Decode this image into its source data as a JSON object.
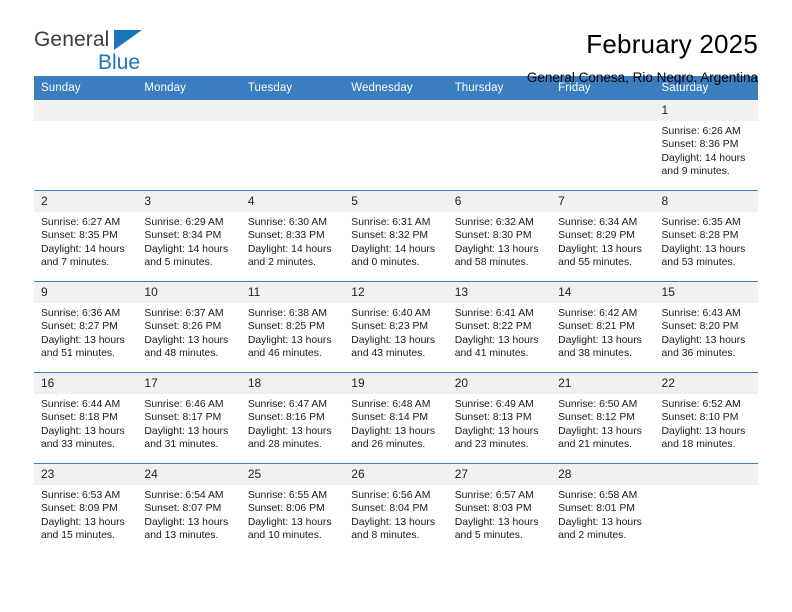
{
  "brand": {
    "name_part1": "General",
    "name_part2": "Blue",
    "triangle_color": "#1b75bb",
    "accent_color": "#3a7ebf"
  },
  "header": {
    "month_title": "February 2025",
    "location": "General Conesa, Rio Negro, Argentina"
  },
  "calendar": {
    "weekdays": [
      "Sunday",
      "Monday",
      "Tuesday",
      "Wednesday",
      "Thursday",
      "Friday",
      "Saturday"
    ],
    "weeks": [
      [
        {
          "day": "",
          "sunrise": "",
          "sunset": "",
          "daylight": "",
          "daylight2": ""
        },
        {
          "day": "",
          "sunrise": "",
          "sunset": "",
          "daylight": "",
          "daylight2": ""
        },
        {
          "day": "",
          "sunrise": "",
          "sunset": "",
          "daylight": "",
          "daylight2": ""
        },
        {
          "day": "",
          "sunrise": "",
          "sunset": "",
          "daylight": "",
          "daylight2": ""
        },
        {
          "day": "",
          "sunrise": "",
          "sunset": "",
          "daylight": "",
          "daylight2": ""
        },
        {
          "day": "",
          "sunrise": "",
          "sunset": "",
          "daylight": "",
          "daylight2": ""
        },
        {
          "day": "1",
          "sunrise": "Sunrise: 6:26 AM",
          "sunset": "Sunset: 8:36 PM",
          "daylight": "Daylight: 14 hours",
          "daylight2": "and 9 minutes."
        }
      ],
      [
        {
          "day": "2",
          "sunrise": "Sunrise: 6:27 AM",
          "sunset": "Sunset: 8:35 PM",
          "daylight": "Daylight: 14 hours",
          "daylight2": "and 7 minutes."
        },
        {
          "day": "3",
          "sunrise": "Sunrise: 6:29 AM",
          "sunset": "Sunset: 8:34 PM",
          "daylight": "Daylight: 14 hours",
          "daylight2": "and 5 minutes."
        },
        {
          "day": "4",
          "sunrise": "Sunrise: 6:30 AM",
          "sunset": "Sunset: 8:33 PM",
          "daylight": "Daylight: 14 hours",
          "daylight2": "and 2 minutes."
        },
        {
          "day": "5",
          "sunrise": "Sunrise: 6:31 AM",
          "sunset": "Sunset: 8:32 PM",
          "daylight": "Daylight: 14 hours",
          "daylight2": "and 0 minutes."
        },
        {
          "day": "6",
          "sunrise": "Sunrise: 6:32 AM",
          "sunset": "Sunset: 8:30 PM",
          "daylight": "Daylight: 13 hours",
          "daylight2": "and 58 minutes."
        },
        {
          "day": "7",
          "sunrise": "Sunrise: 6:34 AM",
          "sunset": "Sunset: 8:29 PM",
          "daylight": "Daylight: 13 hours",
          "daylight2": "and 55 minutes."
        },
        {
          "day": "8",
          "sunrise": "Sunrise: 6:35 AM",
          "sunset": "Sunset: 8:28 PM",
          "daylight": "Daylight: 13 hours",
          "daylight2": "and 53 minutes."
        }
      ],
      [
        {
          "day": "9",
          "sunrise": "Sunrise: 6:36 AM",
          "sunset": "Sunset: 8:27 PM",
          "daylight": "Daylight: 13 hours",
          "daylight2": "and 51 minutes."
        },
        {
          "day": "10",
          "sunrise": "Sunrise: 6:37 AM",
          "sunset": "Sunset: 8:26 PM",
          "daylight": "Daylight: 13 hours",
          "daylight2": "and 48 minutes."
        },
        {
          "day": "11",
          "sunrise": "Sunrise: 6:38 AM",
          "sunset": "Sunset: 8:25 PM",
          "daylight": "Daylight: 13 hours",
          "daylight2": "and 46 minutes."
        },
        {
          "day": "12",
          "sunrise": "Sunrise: 6:40 AM",
          "sunset": "Sunset: 8:23 PM",
          "daylight": "Daylight: 13 hours",
          "daylight2": "and 43 minutes."
        },
        {
          "day": "13",
          "sunrise": "Sunrise: 6:41 AM",
          "sunset": "Sunset: 8:22 PM",
          "daylight": "Daylight: 13 hours",
          "daylight2": "and 41 minutes."
        },
        {
          "day": "14",
          "sunrise": "Sunrise: 6:42 AM",
          "sunset": "Sunset: 8:21 PM",
          "daylight": "Daylight: 13 hours",
          "daylight2": "and 38 minutes."
        },
        {
          "day": "15",
          "sunrise": "Sunrise: 6:43 AM",
          "sunset": "Sunset: 8:20 PM",
          "daylight": "Daylight: 13 hours",
          "daylight2": "and 36 minutes."
        }
      ],
      [
        {
          "day": "16",
          "sunrise": "Sunrise: 6:44 AM",
          "sunset": "Sunset: 8:18 PM",
          "daylight": "Daylight: 13 hours",
          "daylight2": "and 33 minutes."
        },
        {
          "day": "17",
          "sunrise": "Sunrise: 6:46 AM",
          "sunset": "Sunset: 8:17 PM",
          "daylight": "Daylight: 13 hours",
          "daylight2": "and 31 minutes."
        },
        {
          "day": "18",
          "sunrise": "Sunrise: 6:47 AM",
          "sunset": "Sunset: 8:16 PM",
          "daylight": "Daylight: 13 hours",
          "daylight2": "and 28 minutes."
        },
        {
          "day": "19",
          "sunrise": "Sunrise: 6:48 AM",
          "sunset": "Sunset: 8:14 PM",
          "daylight": "Daylight: 13 hours",
          "daylight2": "and 26 minutes."
        },
        {
          "day": "20",
          "sunrise": "Sunrise: 6:49 AM",
          "sunset": "Sunset: 8:13 PM",
          "daylight": "Daylight: 13 hours",
          "daylight2": "and 23 minutes."
        },
        {
          "day": "21",
          "sunrise": "Sunrise: 6:50 AM",
          "sunset": "Sunset: 8:12 PM",
          "daylight": "Daylight: 13 hours",
          "daylight2": "and 21 minutes."
        },
        {
          "day": "22",
          "sunrise": "Sunrise: 6:52 AM",
          "sunset": "Sunset: 8:10 PM",
          "daylight": "Daylight: 13 hours",
          "daylight2": "and 18 minutes."
        }
      ],
      [
        {
          "day": "23",
          "sunrise": "Sunrise: 6:53 AM",
          "sunset": "Sunset: 8:09 PM",
          "daylight": "Daylight: 13 hours",
          "daylight2": "and 15 minutes."
        },
        {
          "day": "24",
          "sunrise": "Sunrise: 6:54 AM",
          "sunset": "Sunset: 8:07 PM",
          "daylight": "Daylight: 13 hours",
          "daylight2": "and 13 minutes."
        },
        {
          "day": "25",
          "sunrise": "Sunrise: 6:55 AM",
          "sunset": "Sunset: 8:06 PM",
          "daylight": "Daylight: 13 hours",
          "daylight2": "and 10 minutes."
        },
        {
          "day": "26",
          "sunrise": "Sunrise: 6:56 AM",
          "sunset": "Sunset: 8:04 PM",
          "daylight": "Daylight: 13 hours",
          "daylight2": "and 8 minutes."
        },
        {
          "day": "27",
          "sunrise": "Sunrise: 6:57 AM",
          "sunset": "Sunset: 8:03 PM",
          "daylight": "Daylight: 13 hours",
          "daylight2": "and 5 minutes."
        },
        {
          "day": "28",
          "sunrise": "Sunrise: 6:58 AM",
          "sunset": "Sunset: 8:01 PM",
          "daylight": "Daylight: 13 hours",
          "daylight2": "and 2 minutes."
        },
        {
          "day": "",
          "sunrise": "",
          "sunset": "",
          "daylight": "",
          "daylight2": ""
        }
      ]
    ]
  }
}
